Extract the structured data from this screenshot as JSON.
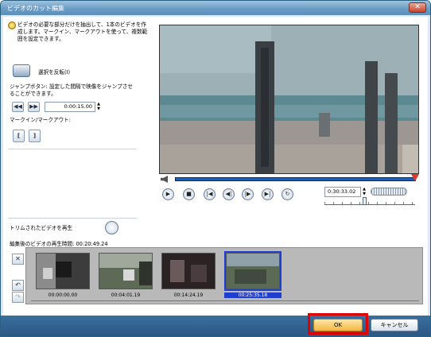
{
  "window": {
    "title": "ビデオのカット編集",
    "close_label": "✕"
  },
  "description": "ビデオの必要な部分だけを抽出して、1本のビデオを作成します。マークイン、マークアウトを使って、複数範囲を設定できます。",
  "invert_selection": {
    "label": "選択を反転(I)"
  },
  "jump": {
    "description": "ジャンプボタン: 設定した間隔で映像をジャンプさせることができます。",
    "interval": "0:00:15.00",
    "back_label": "◀◀",
    "fwd_label": "▶▶"
  },
  "markinout": {
    "label": "マークイン/マークアウト:",
    "markin_label": "[",
    "markout_label": "]"
  },
  "player": {
    "timecode": "0:30:33.02",
    "buttons": [
      "▶",
      "■",
      "|◀",
      "◀|",
      "|▶",
      "▶|",
      "↻"
    ]
  },
  "trim_play": {
    "label": "トリムされたビデオを再生"
  },
  "duration": {
    "label": "編集後のビデオの再生時間:",
    "value": "00:20:49.24"
  },
  "clips": [
    {
      "time": "00:00:00.00",
      "selected": false
    },
    {
      "time": "00:04:01.19",
      "selected": false
    },
    {
      "time": "00:14:24.19",
      "selected": false
    },
    {
      "time": "00:25:35.18",
      "selected": true
    }
  ],
  "side_buttons": [
    "✕",
    "↶",
    "↷"
  ],
  "buttons": {
    "ok": "OK",
    "cancel": "キャンセル"
  },
  "colors": {
    "accent": "#1f5eb1",
    "highlight": "#e00000",
    "ok": "#f7c560"
  }
}
